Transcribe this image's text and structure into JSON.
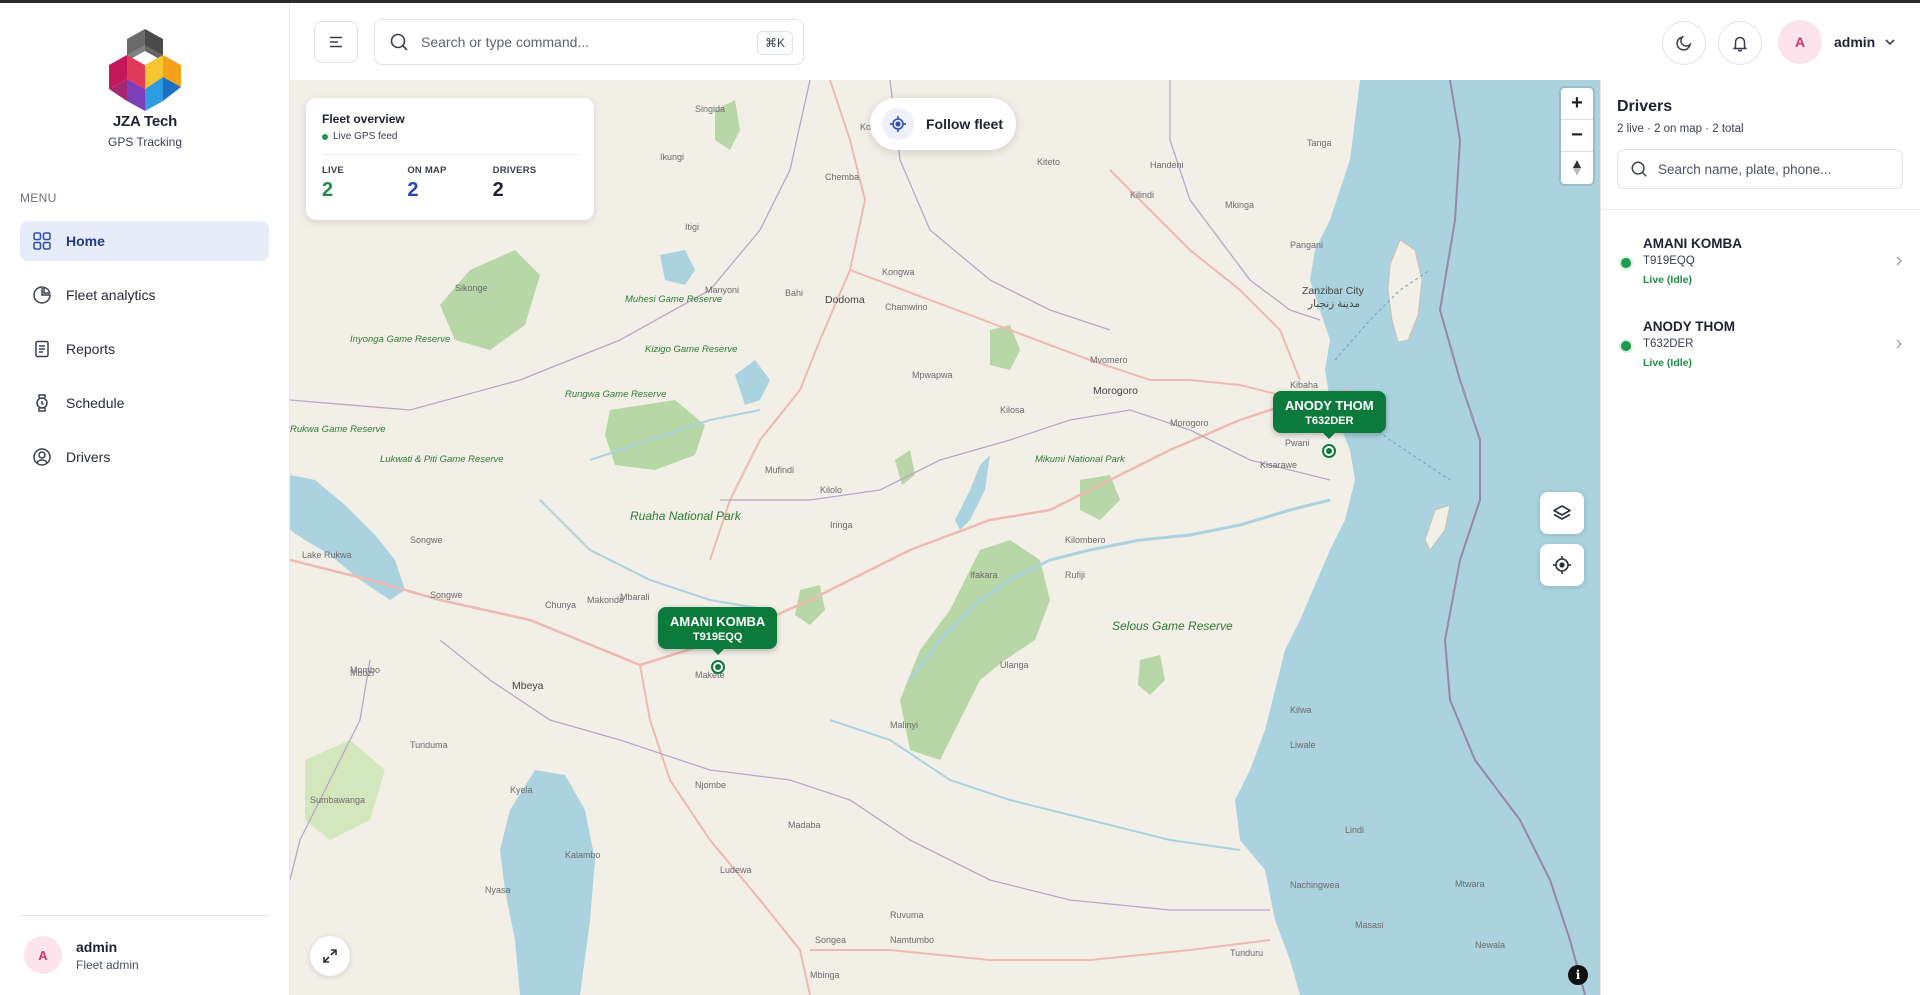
{
  "app": {
    "brand": "JZA Tech",
    "subtitle": "GPS Tracking",
    "colors": {
      "accent": "#233a8a",
      "live": "#1f9a4f",
      "marker": "#0b7a3b",
      "avatar": "#d6336c"
    }
  },
  "sidebar": {
    "menu_label": "MENU",
    "items": [
      {
        "label": "Home",
        "icon": "grid-icon",
        "active": true
      },
      {
        "label": "Fleet analytics",
        "icon": "pie-chart-icon",
        "active": false
      },
      {
        "label": "Reports",
        "icon": "document-icon",
        "active": false
      },
      {
        "label": "Schedule",
        "icon": "clock-icon",
        "active": false
      },
      {
        "label": "Drivers",
        "icon": "user-circle-icon",
        "active": false
      }
    ],
    "footer": {
      "avatar_letter": "A",
      "name": "admin",
      "role": "Fleet admin"
    }
  },
  "header": {
    "search_placeholder": "Search or type command...",
    "shortcut": "⌘K",
    "user": {
      "avatar_letter": "A",
      "name": "admin"
    }
  },
  "map": {
    "fleet_overview": {
      "title": "Fleet overview",
      "feed": "Live GPS feed",
      "stats": [
        {
          "label": "LIVE",
          "value": "2",
          "color": "#1f8a45"
        },
        {
          "label": "ON MAP",
          "value": "2",
          "color": "#2a44b8"
        },
        {
          "label": "DRIVERS",
          "value": "2",
          "color": "#1e2233"
        }
      ]
    },
    "follow_label": "Follow fleet",
    "zoom_in": "+",
    "zoom_out": "−",
    "markers": [
      {
        "name": "AMANI KOMBA",
        "plate": "T919EQQ"
      },
      {
        "name": "ANODY THOM",
        "plate": "T632DER"
      }
    ],
    "labels": {
      "singida": "Singida",
      "dodoma": "Dodoma",
      "morogoro": "Morogoro",
      "mbeya": "Mbeya",
      "zanzibar": "Zanzibar City",
      "zanzibar_ar": "مدينة زنجبار",
      "ruaha": "Ruaha National Park",
      "selous": "Selous Game Reserve",
      "ikungi": "Ikungi",
      "chemba": "Chemba",
      "kondoa": "Kondoa",
      "manyoni": "Manyoni",
      "iringa": "Iringa",
      "tanga": "Tanga",
      "handeni": "Handeni",
      "kilosa": "Kilosa",
      "mikumi": "Mikumi National Park",
      "mbarali": "Mbarali",
      "makete": "Makete",
      "njombe": "Njombe",
      "songea": "Songea",
      "tunduru": "Tunduru",
      "mtwara": "Mtwara",
      "lindi": "Lindi",
      "kilwa": "Kilwa",
      "ifakara": "Ifakara",
      "ulanga": "Ulanga",
      "tunduma": "Tunduma",
      "rungwa": "Rungwa Game Reserve",
      "kizigo": "Kizigo Game Reserve",
      "muhesi": "Muhesi Game Reserve",
      "inyonga": "Inyonga Game Reserve",
      "lukwati": "Lukwati & Piti Game Reserve",
      "rukwa": "Rukwa Game Reserve",
      "lake_rukwa": "Lake Rukwa",
      "sumbawanga": "Sumbawanga",
      "mombo": "Mombo",
      "kalambo": "Kalambo",
      "chunya": "Chunya",
      "songwe": "Songwe",
      "mbozi": "Mbozi",
      "kyela": "Kyela",
      "ludewa": "Ludewa",
      "madaba": "Madaba",
      "ruvuma": "Ruvuma",
      "namtumbo": "Namtumbo",
      "kilombero": "Kilombero",
      "pwani": "Pwani",
      "kibaha": "Kibaha",
      "kilindi": "Kilindi",
      "mvomero": "Mvomero",
      "kiteto": "Kiteto",
      "kongwa": "Kongwa",
      "mpwapwa": "Mpwapwa",
      "bahi": "Bahi",
      "chamwino": "Chamwino",
      "malinyi": "Malinyi",
      "liwale": "Liwale",
      "nachingwea": "Nachingwea",
      "masasi": "Masasi",
      "newala": "Newala",
      "rufiji": "Rufiji",
      "kisarawe": "Kisarawe",
      "mufindi": "Mufindi",
      "kilolo": "Kilolo",
      "makambako": "Makambako",
      "makonde": "Makonde",
      "mbinga": "Mbinga",
      "nyasa": "Nyasa",
      "mkinga": "Mkinga",
      "pangani": "Pangani",
      "kigoma": "Itigi",
      "tabora": "Sikonge"
    }
  },
  "drivers_panel": {
    "title": "Drivers",
    "summary": "2 live · 2 on map · 2 total",
    "search_placeholder": "Search name, plate, phone...",
    "items": [
      {
        "name": "AMANI KOMBA",
        "plate": "T919EQQ",
        "status": "Live (Idle)"
      },
      {
        "name": "ANODY THOM",
        "plate": "T632DER",
        "status": "Live (Idle)"
      }
    ]
  }
}
